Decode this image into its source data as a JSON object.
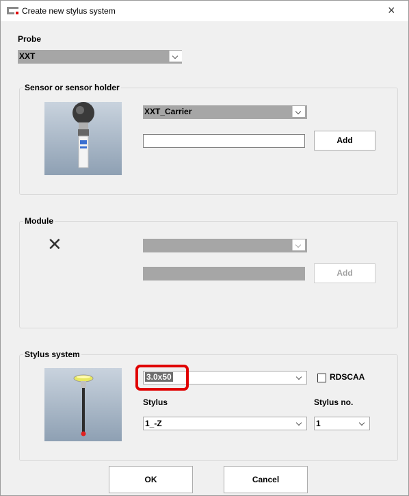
{
  "window": {
    "title": "Create new stylus system",
    "close_glyph": "×"
  },
  "probe": {
    "label": "Probe",
    "selected": "XXT"
  },
  "sensor_group": {
    "label": "Sensor or sensor holder",
    "selected": "XXT_Carrier",
    "text_value": "",
    "add_label": "Add"
  },
  "module_group": {
    "label": "Module",
    "selected": "",
    "text_value": "",
    "add_label": "Add",
    "empty_glyph": "✕"
  },
  "stylus_group": {
    "label": "Stylus system",
    "selected": "3.0x50",
    "rdscaa_label": "RDSCAA",
    "rdscaa_checked": false,
    "stylus_label": "Stylus",
    "stylus_value": "1_-Z",
    "stylus_no_label": "Stylus no.",
    "stylus_no_value": "1"
  },
  "buttons": {
    "ok": "OK",
    "cancel": "Cancel"
  },
  "colors": {
    "highlight": "#e00000",
    "disabled": "#a6a6a6",
    "dialog_bg": "#f0f0f0"
  }
}
